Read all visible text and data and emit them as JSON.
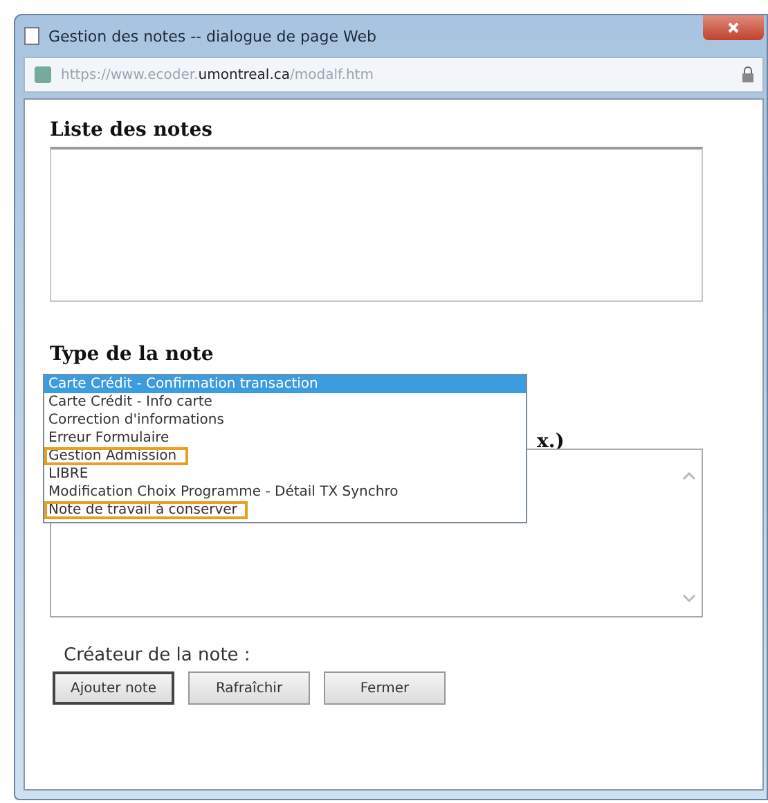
{
  "window": {
    "title": "Gestion des notes -- dialogue de page Web",
    "url": "https://www.ecoder.**umontreal.ca**/modalf.htm"
  },
  "notes_list": {
    "heading": "Liste des notes"
  },
  "note_type": {
    "heading": "Type de la note",
    "options": [
      {
        "label": "Carte Crédit - Confirmation transaction",
        "selected": true,
        "highlighted": false
      },
      {
        "label": "Carte Crédit - Info carte",
        "selected": false,
        "highlighted": false
      },
      {
        "label": "Correction d'informations",
        "selected": false,
        "highlighted": false
      },
      {
        "label": "Erreur Formulaire",
        "selected": false,
        "highlighted": false
      },
      {
        "label": "Gestion Admission",
        "selected": false,
        "highlighted": true
      },
      {
        "label": "LIBRE",
        "selected": false,
        "highlighted": false
      },
      {
        "label": "Modification Choix Programme - Détail TX Synchro",
        "selected": false,
        "highlighted": false
      },
      {
        "label": "Note de travail à conserver",
        "selected": false,
        "highlighted": true
      }
    ]
  },
  "note_text": {
    "heading_visible_part": "x.)"
  },
  "creator": {
    "label": "Créateur de la note :"
  },
  "buttons": [
    {
      "label": "Ajouter note",
      "focused": true
    },
    {
      "label": "Rafraîchir",
      "focused": false
    },
    {
      "label": "Fermer",
      "focused": false
    }
  ]
}
